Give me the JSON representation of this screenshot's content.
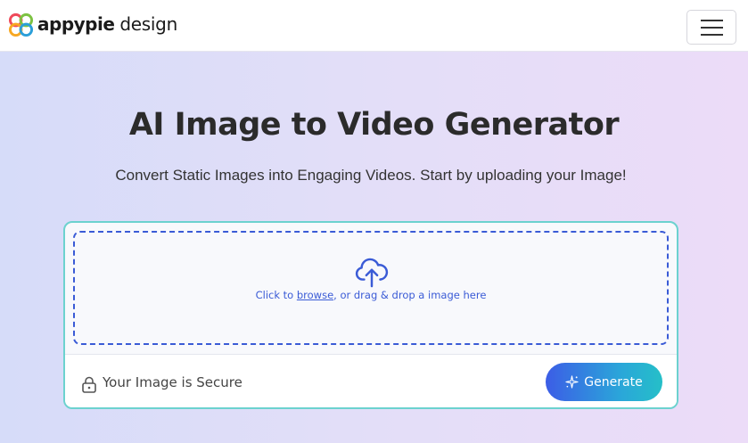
{
  "brand": {
    "name_bold": "appypie",
    "name_regular": "design"
  },
  "nav": {
    "menu_icon": "hamburger-icon"
  },
  "hero": {
    "title": "AI Image to Video Generator",
    "subtitle": "Convert Static Images into Engaging Videos. Start by uploading your Image!"
  },
  "upload": {
    "icon": "cloud-upload-icon",
    "prefix": "Click to ",
    "browse_link": "browse",
    "suffix": ", or drag & drop a image here",
    "secure_text": "Your Image is Secure",
    "secure_icon": "lock-icon",
    "generate_label": "Generate",
    "generate_icon": "sparkle-icon"
  },
  "colors": {
    "accent_blue": "#3a5bd6",
    "border_teal": "#6cd2cf",
    "button_gradient_start": "#3c5de6",
    "button_gradient_end": "#25bfc8"
  }
}
